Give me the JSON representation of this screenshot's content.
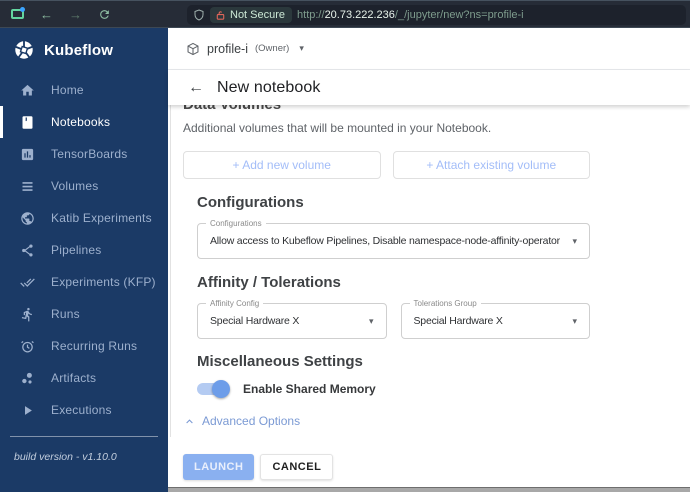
{
  "browser": {
    "security_label": "Not Secure",
    "url_scheme": "http://",
    "url_domain": "20.73.222.236",
    "url_path": "/_/jupyter/new?ns=profile-i"
  },
  "sidebar": {
    "logo_text": "Kubeflow",
    "active_item": "Notebooks",
    "items": [
      {
        "label": "Home",
        "icon": "home-icon"
      },
      {
        "label": "Notebooks",
        "icon": "notebook-icon"
      },
      {
        "label": "TensorBoards",
        "icon": "bar-chart-icon"
      },
      {
        "label": "Volumes",
        "icon": "list-icon"
      },
      {
        "label": "Katib Experiments",
        "icon": "globe-icon"
      },
      {
        "label": "Pipelines",
        "icon": "pipeline-icon"
      },
      {
        "label": "Experiments (KFP)",
        "icon": "double-check-icon"
      },
      {
        "label": "Runs",
        "icon": "runner-icon"
      },
      {
        "label": "Recurring Runs",
        "icon": "alarm-clock-icon"
      },
      {
        "label": "Artifacts",
        "icon": "bubble-chart-icon"
      },
      {
        "label": "Executions",
        "icon": "play-icon"
      }
    ],
    "build_version": "build version - v1.10.0"
  },
  "header": {
    "namespace": "profile-i",
    "namespace_role": "(Owner)",
    "page_title": "New notebook"
  },
  "form": {
    "data_volumes": {
      "title": "Data Volumes",
      "description": "Additional volumes that will be mounted in your Notebook.",
      "add_button": "+ Add new volume",
      "attach_button": "+ Attach existing volume"
    },
    "configurations": {
      "title": "Configurations",
      "field_label": "Configurations",
      "field_value": "Allow access to Kubeflow Pipelines, Disable namespace-node-affinity-operator"
    },
    "affinity_tolerations": {
      "title": "Affinity / Tolerations",
      "affinity_label": "Affinity Config",
      "affinity_value": "Special Hardware X",
      "tolerations_label": "Tolerations Group",
      "tolerations_value": "Special Hardware X"
    },
    "misc": {
      "title": "Miscellaneous Settings",
      "shared_memory_label": "Enable Shared Memory",
      "shared_memory_enabled": true
    },
    "advanced_options_label": "Advanced Options",
    "launch_label": "LAUNCH",
    "cancel_label": "CANCEL"
  },
  "colors": {
    "sidebar_bg": "#1b3a66",
    "browser_bar_bg": "#262c37",
    "launch_bg": "#8ab0f0",
    "link_blue": "#7b9ad4",
    "toggle_thumb": "#6d9de9",
    "toggle_track": "#b4cbf2"
  }
}
